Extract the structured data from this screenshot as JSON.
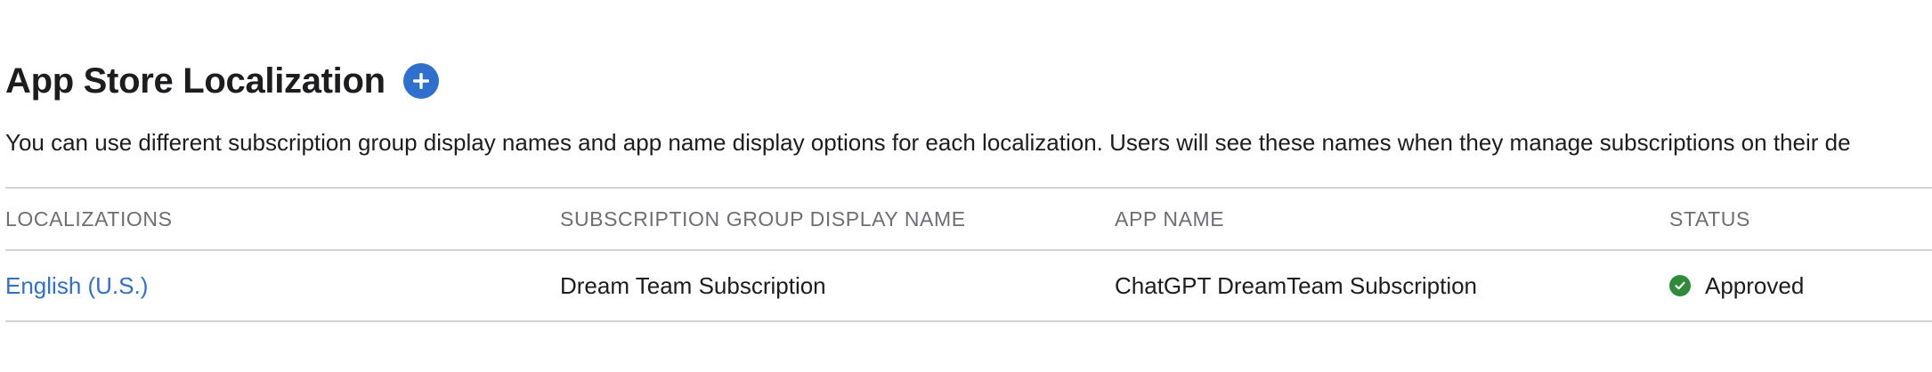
{
  "section": {
    "title": "App Store Localization",
    "add_icon": "plus-circle-icon",
    "description": "You can use different subscription group display names and app name display options for each localization. Users will see these names when they manage subscriptions on their de"
  },
  "table": {
    "headers": [
      "LOCALIZATIONS",
      "SUBSCRIPTION GROUP DISPLAY NAME",
      "APP NAME",
      "STATUS"
    ],
    "rows": [
      {
        "localization": "English (U.S.)",
        "group_display_name": "Dream Team Subscription",
        "app_name": "ChatGPT DreamTeam Subscription",
        "status": "Approved",
        "status_icon": "check-circle-icon"
      }
    ]
  },
  "colors": {
    "accent": "#2f6fce",
    "link": "#2f6fce",
    "status_ok": "#2e8b3a"
  }
}
